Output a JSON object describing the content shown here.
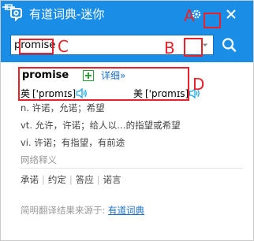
{
  "window": {
    "title": "有道词典-迷你"
  },
  "search": {
    "value": "promise"
  },
  "result": {
    "word": "promise",
    "detail_link": "详细»",
    "pronunciations": [
      {
        "region": "英",
        "phonetic": "['prɒmɪs]"
      },
      {
        "region": "美",
        "phonetic": "['prɑmɪs]"
      }
    ],
    "definitions": [
      "n. 许诺，允诺；希望",
      "vt. 允许，许诺；给人以…的指望或希望",
      "vi. 许诺；有指望，有前途"
    ]
  },
  "web_translation": {
    "title": "网络释义",
    "terms": [
      "承诺",
      "约定",
      "答应",
      "诺言"
    ],
    "separator": "|"
  },
  "footer": {
    "prefix": "简明翻译结果来源于:",
    "link": "有道词典"
  },
  "annotations": {
    "a": "A",
    "b": "B",
    "c": "C",
    "d": "D"
  },
  "colors": {
    "titlebar": "#1a8ee6",
    "link": "#1a6fc9",
    "speaker": "#1aa6e8",
    "add_icon": "#2aa336",
    "annotation": "#e8212b"
  },
  "icons": {
    "logo": "youdao-logo-icon",
    "settings": "gear-icon",
    "pin": "pin-icon",
    "close": "close-icon",
    "dropdown": "chevron-down-icon",
    "search": "search-icon",
    "add": "add-to-wordbook-icon",
    "speaker": "speaker-icon"
  }
}
